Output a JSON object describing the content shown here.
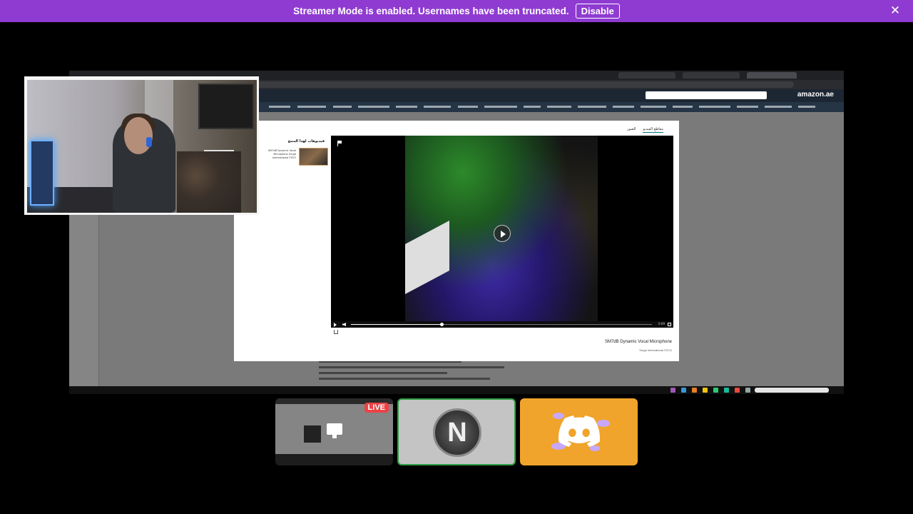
{
  "banner": {
    "message": "Streamer Mode is enabled. Usernames have been truncated.",
    "disable_label": "Disable",
    "close_glyph": "✕"
  },
  "shared_screen": {
    "modal": {
      "tabs": [
        "مقاطع الفيديو",
        "الصور"
      ],
      "related_heading": "فيديوهات لهذا المنتج",
      "related_item": "SM7dB Dynamic Vocal Microphone Surge International FZCO",
      "video_time": "0:09",
      "video_progress": 0.3,
      "product_title": "SM7dB Dynamic Vocal Microphone",
      "product_seller": "Surge International FZCO"
    },
    "amazon_logo": "amazon.ae"
  },
  "tiles": {
    "live_label": "LIVE",
    "user_initial": "N"
  },
  "colors": {
    "banner_bg": "#8f3bd1",
    "speaking_border": "#2f9e44",
    "live_red": "#ed4245",
    "discord_tile_bg": "#f0a42b"
  },
  "icons": {
    "close": "close-icon",
    "play": "play-icon",
    "monitor": "monitor-icon",
    "discord": "discord-logo-icon"
  }
}
